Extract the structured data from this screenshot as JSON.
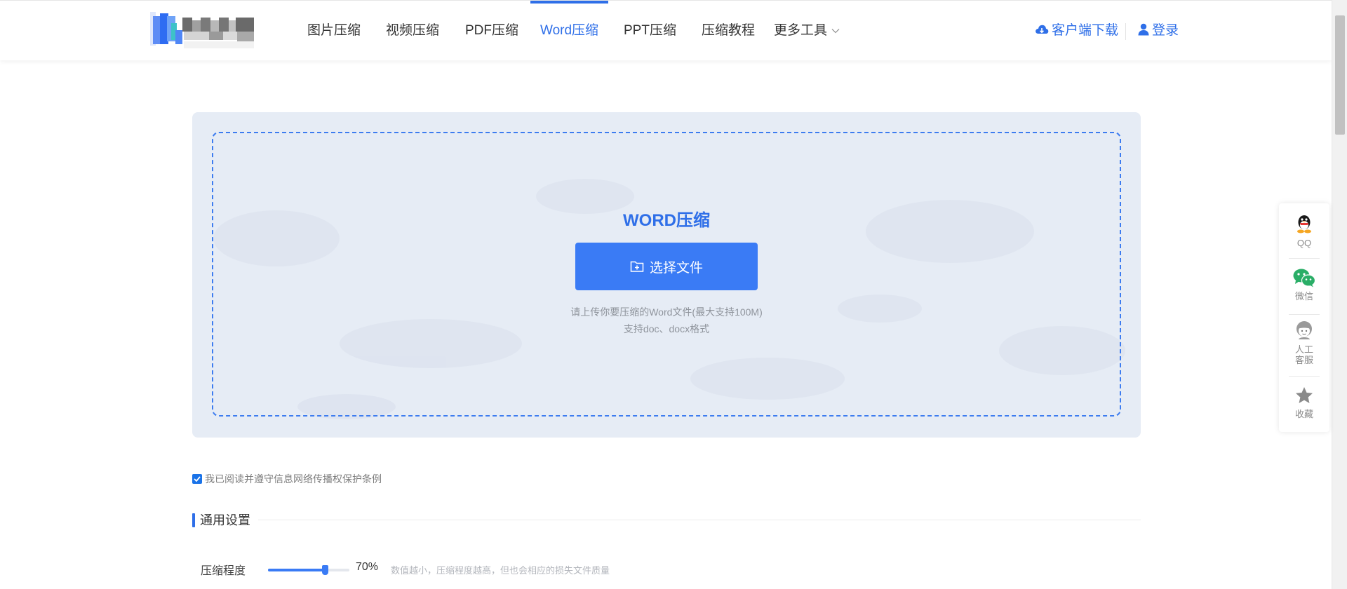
{
  "header": {
    "nav": [
      {
        "label": "图片压缩",
        "active": false
      },
      {
        "label": "视频压缩",
        "active": false
      },
      {
        "label": "PDF压缩",
        "active": false
      },
      {
        "label": "Word压缩",
        "active": true
      },
      {
        "label": "PPT压缩",
        "active": false
      },
      {
        "label": "压缩教程",
        "active": false
      },
      {
        "label": "更多工具",
        "active": false
      }
    ],
    "download_label": "客户端下载",
    "login_label": "登录"
  },
  "upload": {
    "title": "WORD压缩",
    "button_label": "选择文件",
    "hint_line1": "请上传你要压缩的Word文件(最大支持100M)",
    "hint_line2": "支持doc、docx格式"
  },
  "agreement": {
    "checked": true,
    "label": "我已阅读并遵守信息网络传播权保护条例"
  },
  "settings": {
    "section_title": "通用设置",
    "compression_label": "压缩程度",
    "compression_value": "70%",
    "compression_level": 0.7,
    "compression_note": "数值越小，压缩程度越高，但也会相应的损失文件质量"
  },
  "side_toolbar": [
    {
      "label": "QQ",
      "icon": "qq-icon"
    },
    {
      "label": "微信",
      "icon": "wechat-icon"
    },
    {
      "label": "人工客服",
      "icon": "customer-service-icon"
    },
    {
      "label": "收藏",
      "icon": "star-icon"
    }
  ],
  "colors": {
    "accent": "#2f6fe8",
    "button": "#3a7bf5",
    "panel_bg": "#e6ecf5",
    "wechat": "#2aae67"
  }
}
